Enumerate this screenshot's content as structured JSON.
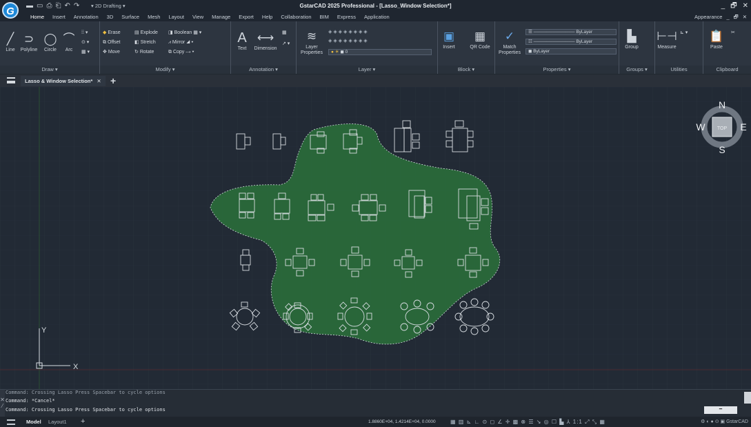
{
  "app": {
    "logo_letter": "G",
    "title": "GstarCAD 2025 Professional - [Lasso_Window Selection*]",
    "workspace": "2D Drafting",
    "window_controls": [
      "_",
      "🗗",
      "✕"
    ]
  },
  "menubar": {
    "tabs": [
      "Home",
      "Insert",
      "Annotation",
      "3D",
      "Surface",
      "Mesh",
      "Layout",
      "View",
      "Manage",
      "Export",
      "Help",
      "Collaboration",
      "BIM",
      "Express",
      "Application"
    ],
    "active_tab": "Home",
    "appearance": "Appearance",
    "right_controls": [
      "_",
      "🗗",
      "✕"
    ]
  },
  "ribbon": {
    "draw": {
      "label": "Draw",
      "tools": [
        "Line",
        "Polyline",
        "Circle",
        "Arc"
      ]
    },
    "modify": {
      "label": "Modify",
      "tools": [
        "Erase",
        "Explode",
        "Boolean",
        "Offset",
        "Stretch",
        "Mirror",
        "Move",
        "Rotate",
        "Copy"
      ]
    },
    "annotation": {
      "label": "Annotation",
      "tools": [
        "Text",
        "Dimension"
      ]
    },
    "layer": {
      "label": "Layer",
      "properties": "Layer Properties",
      "current_layer": "0"
    },
    "block": {
      "label": "Block",
      "insert": "Insert",
      "qr": "QR Code"
    },
    "properties": {
      "label": "Properties",
      "match": "Match Properties",
      "color": "ByLayer",
      "linetype": "ByLayer",
      "lineweight": "ByLayer"
    },
    "groups": {
      "label": "Groups",
      "group": "Group"
    },
    "utilities": {
      "label": "Utilities",
      "measure": "Measure"
    },
    "clipboard": {
      "label": "Clipboard",
      "paste": "Paste"
    }
  },
  "document": {
    "tab_label": "Lasso & Window Selection*",
    "close_icon": "✕",
    "add_icon": "+"
  },
  "viewcube": {
    "n": "N",
    "s": "S",
    "e": "E",
    "w": "W",
    "top": "TOP"
  },
  "ucs": {
    "x": "X",
    "y": "Y"
  },
  "command": {
    "line1": "Command: Crossing Lasso  Press Spacebar to cycle options",
    "line2": "Command: *Cancel*",
    "line3": "Command: Crossing Lasso  Press Spacebar to cycle options"
  },
  "status": {
    "model": "Model",
    "layout": "Layout1",
    "add": "+",
    "coords": "1.8860E+04, 1.4214E+04, 0.0000",
    "brand": "GstarCAD"
  },
  "colors": {
    "canvas": "#222a35",
    "lasso_fill": "#2a6b3a",
    "accent": "#1e88d8"
  }
}
